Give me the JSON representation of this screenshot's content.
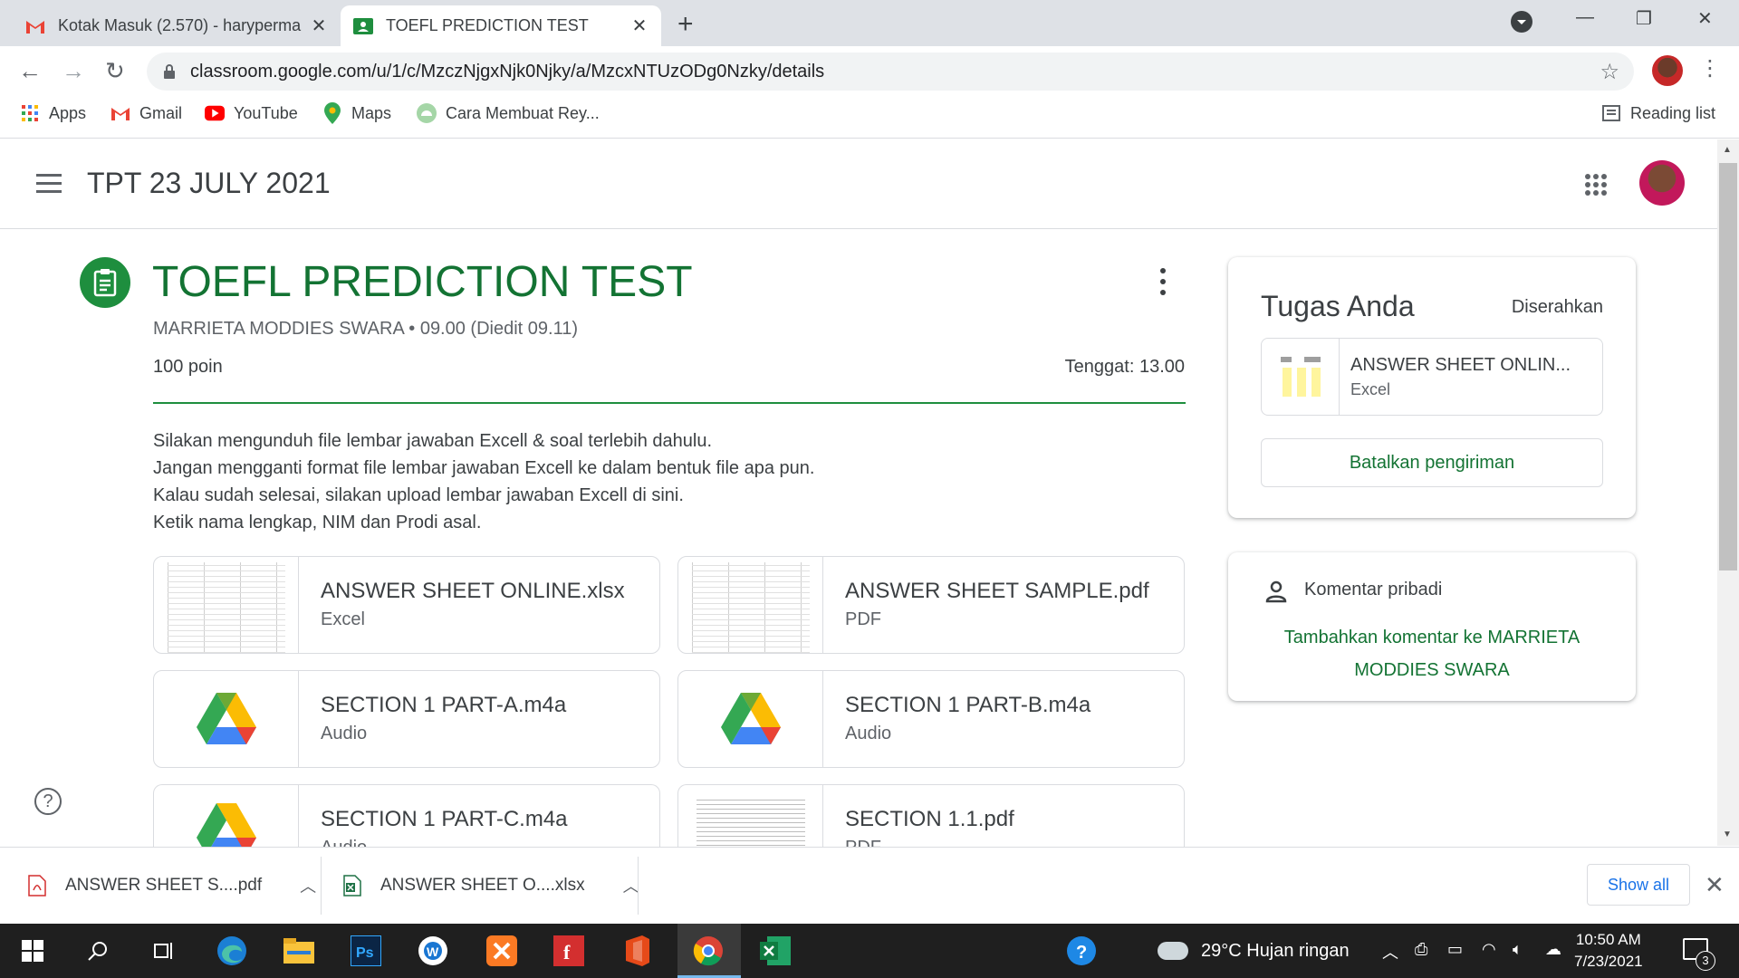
{
  "browser": {
    "tabs": [
      {
        "title": "Kotak Masuk (2.570) - haryperma",
        "icon": "gmail-icon",
        "active": false
      },
      {
        "title": "TOEFL PREDICTION TEST",
        "icon": "classroom-icon",
        "active": true
      }
    ],
    "url": "classroom.google.com/u/1/c/MzczNjgxNjk0Njky/a/MzcxNTUzODg0Nzky/details",
    "bookmarks": [
      {
        "label": "Apps",
        "icon": "apps-grid-icon"
      },
      {
        "label": "Gmail",
        "icon": "gmail-icon"
      },
      {
        "label": "YouTube",
        "icon": "youtube-icon"
      },
      {
        "label": "Maps",
        "icon": "maps-pin-icon"
      },
      {
        "label": "Cara Membuat Rey...",
        "icon": "android-icon"
      }
    ],
    "reading_list": "Reading list"
  },
  "classroom": {
    "class_title": "TPT 23 JULY 2021",
    "assignment": {
      "title": "TOEFL PREDICTION TEST",
      "meta": "MARRIETA MODDIES SWARA • 09.00 (Diedit 09.11)",
      "points": "100 poin",
      "due": "Tenggat: 13.00",
      "instructions": [
        "Silakan mengunduh file lembar jawaban Excell & soal terlebih dahulu.",
        "Jangan mengganti format file lembar jawaban Excell ke dalam bentuk file apa pun.",
        "Kalau sudah selesai, silakan upload lembar jawaban Excell di sini.",
        "Ketik nama lengkap, NIM dan Prodi asal."
      ],
      "attachments": [
        {
          "name": "ANSWER SHEET ONLINE.xlsx",
          "type": "Excel",
          "thumb": "spreadsheet"
        },
        {
          "name": "ANSWER SHEET SAMPLE.pdf",
          "type": "PDF",
          "thumb": "spreadsheet"
        },
        {
          "name": "SECTION 1 PART-A.m4a",
          "type": "Audio",
          "thumb": "drive"
        },
        {
          "name": "SECTION 1 PART-B.m4a",
          "type": "Audio",
          "thumb": "drive"
        },
        {
          "name": "SECTION 1 PART-C.m4a",
          "type": "Audio",
          "thumb": "drive"
        },
        {
          "name": "SECTION 1.1.pdf",
          "type": "PDF",
          "thumb": "document"
        }
      ]
    },
    "your_work": {
      "title": "Tugas Anda",
      "status": "Diserahkan",
      "file_name": "ANSWER SHEET ONLIN...",
      "file_type": "Excel",
      "unsubmit_label": "Batalkan pengiriman"
    },
    "private_comments": {
      "label": "Komentar pribadi",
      "add_label": "Tambahkan komentar ke MARRIETA MODDIES SWARA"
    }
  },
  "downloads": {
    "items": [
      {
        "name": "ANSWER SHEET S....pdf",
        "icon": "pdf-file-icon"
      },
      {
        "name": "ANSWER SHEET O....xlsx",
        "icon": "excel-file-icon"
      }
    ],
    "show_all": "Show all"
  },
  "taskbar": {
    "weather": "29°C  Hujan ringan",
    "time": "10:50 AM",
    "date": "7/23/2021",
    "notifications": "3"
  },
  "colors": {
    "classroom_green": "#137333",
    "accent_green": "#1e8e3e",
    "link_blue": "#1a73e8"
  }
}
